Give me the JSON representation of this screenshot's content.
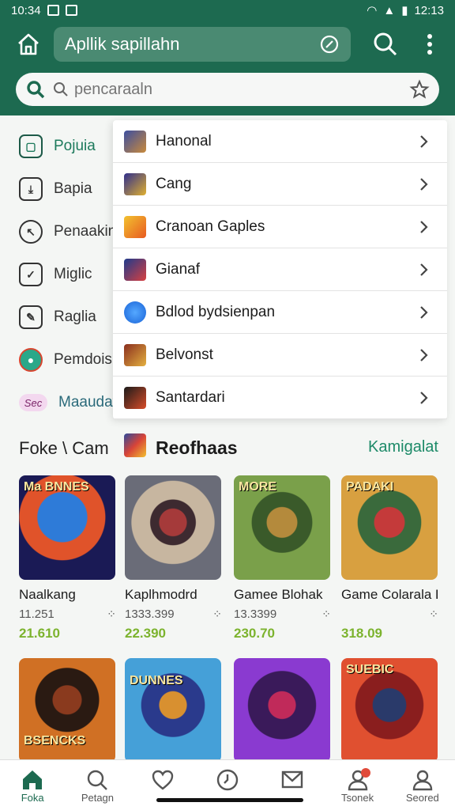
{
  "status_bar": {
    "time": "10:34",
    "right_time": "12:13"
  },
  "app_bar": {
    "title": "Apllik sapillahn",
    "search_placeholder": "pencaraaln"
  },
  "sidebar": {
    "items": [
      {
        "label": "Pojuia",
        "icon": "square-icon"
      },
      {
        "label": "Bapia",
        "icon": "download-icon"
      },
      {
        "label": "Penaakin",
        "icon": "arrow-icon"
      },
      {
        "label": "Miglic",
        "icon": "check-icon"
      },
      {
        "label": "Raglia",
        "icon": "pen-icon"
      },
      {
        "label": "Pemdois",
        "icon": "app-icon"
      },
      {
        "label": "Maaudat",
        "icon": "badge-icon",
        "badge_text": "Sec"
      }
    ]
  },
  "menu": {
    "items": [
      {
        "label": "Hanonal"
      },
      {
        "label": "Cang"
      },
      {
        "label": "Cranoan Gaples"
      },
      {
        "label": "Gianaf"
      },
      {
        "label": "Bdlod bydsienpan"
      },
      {
        "label": "Belvonst"
      },
      {
        "label": "Santardari"
      }
    ]
  },
  "section": {
    "left_heading": "Foke \\ Cam",
    "title": "Reofhaas",
    "more_link": "Kamigalat"
  },
  "games": [
    {
      "name": "Naalkang",
      "stat": "11.251",
      "price": "21.610",
      "overlay": "Ma BNNES"
    },
    {
      "name": "Kaplhmodrd",
      "stat": "1333.399",
      "price": "22.390",
      "overlay": ""
    },
    {
      "name": "Gamee Blohak",
      "stat": "13.3399",
      "price": "230.70",
      "overlay": "MORE"
    },
    {
      "name": "Game Colarala Dloh",
      "stat": "",
      "price": "318.09",
      "overlay": "PADAKI"
    },
    {
      "name": "",
      "stat": "",
      "price": "",
      "overlay": "BSENCKS"
    },
    {
      "name": "",
      "stat": "",
      "price": "",
      "overlay": "DUNNES"
    },
    {
      "name": "",
      "stat": "",
      "price": "",
      "overlay": ""
    },
    {
      "name": "",
      "stat": "",
      "price": "",
      "overlay": "SUEBIC"
    }
  ],
  "bottom_nav": {
    "items": [
      {
        "label": "Foka",
        "icon": "home-icon",
        "active": true
      },
      {
        "label": "Petagn",
        "icon": "search-icon"
      },
      {
        "label": "",
        "icon": "heart-icon"
      },
      {
        "label": "",
        "icon": "clock-icon"
      },
      {
        "label": "",
        "icon": "mail-icon"
      },
      {
        "label": "Tsonek",
        "icon": "profile-icon"
      },
      {
        "label": "Seored",
        "icon": "user-icon"
      }
    ]
  },
  "colors": {
    "primary": "#1d6a50",
    "accent_green": "#1d8a68",
    "price_green": "#7cb32e"
  }
}
